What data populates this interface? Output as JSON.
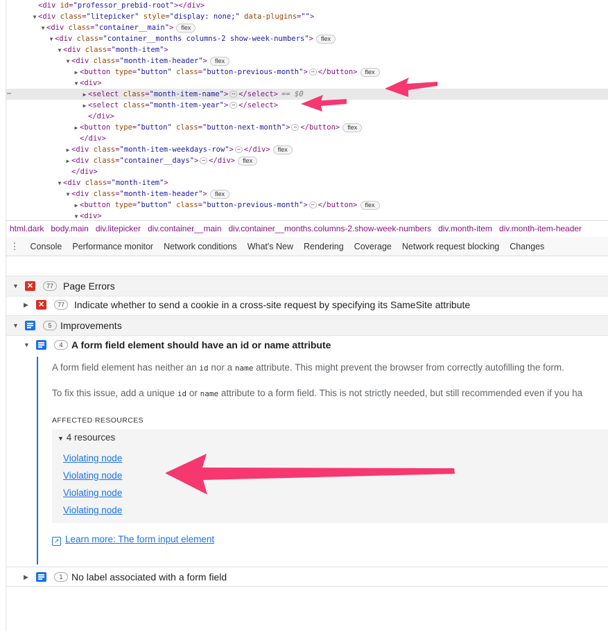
{
  "elements_tree": {
    "lines": [
      {
        "indent": 2,
        "toggle": "",
        "open": "<div ",
        "attrs": [
          {
            "n": "id",
            "v": "professor_prebid-root"
          }
        ],
        "close": "></div>",
        "badge": ""
      },
      {
        "indent": 2,
        "toggle": "▼",
        "open": "<div ",
        "attrs": [
          {
            "n": "class",
            "v": "litepicker"
          },
          {
            "n": "style",
            "v": "display: none;"
          },
          {
            "n": "data-plugins",
            "v": ""
          }
        ],
        "close": ">",
        "badge": ""
      },
      {
        "indent": 3,
        "toggle": "▼",
        "open": "<div ",
        "attrs": [
          {
            "n": "class",
            "v": "container__main"
          }
        ],
        "close": ">",
        "badge": "flex"
      },
      {
        "indent": 4,
        "toggle": "▼",
        "open": "<div ",
        "attrs": [
          {
            "n": "class",
            "v": "container__months columns-2 show-week-numbers"
          }
        ],
        "close": ">",
        "badge": "flex"
      },
      {
        "indent": 5,
        "toggle": "▼",
        "open": "<div ",
        "attrs": [
          {
            "n": "class",
            "v": "month-item"
          }
        ],
        "close": ">",
        "badge": ""
      },
      {
        "indent": 6,
        "toggle": "▼",
        "open": "<div ",
        "attrs": [
          {
            "n": "class",
            "v": "month-item-header"
          }
        ],
        "close": ">",
        "badge": "flex"
      },
      {
        "indent": 7,
        "toggle": "▶",
        "open": "<button ",
        "attrs": [
          {
            "n": "type",
            "v": "button"
          },
          {
            "n": "class",
            "v": "button-previous-month"
          }
        ],
        "close": ">",
        "ellipsis": true,
        "end": "</button>",
        "badge": "flex"
      },
      {
        "indent": 7,
        "toggle": "▼",
        "open": "<div>",
        "attrs": [],
        "close": "",
        "badge": ""
      },
      {
        "indent": 8,
        "toggle": "▶",
        "open": "<select ",
        "attrs": [
          {
            "n": "class",
            "v": "month-item-name"
          }
        ],
        "close": ">",
        "ellipsis": true,
        "end": "</select>",
        "badge": "",
        "selected": true,
        "dollar": "== $0"
      },
      {
        "indent": 8,
        "toggle": "▶",
        "open": "<select ",
        "attrs": [
          {
            "n": "class",
            "v": "month-item-year"
          }
        ],
        "close": ">",
        "ellipsis": true,
        "end": "</select>",
        "badge": ""
      },
      {
        "indent": 8,
        "toggle": "",
        "open": "</div>",
        "attrs": [],
        "close": "",
        "badge": ""
      },
      {
        "indent": 7,
        "toggle": "▶",
        "open": "<button ",
        "attrs": [
          {
            "n": "type",
            "v": "button"
          },
          {
            "n": "class",
            "v": "button-next-month"
          }
        ],
        "close": ">",
        "ellipsis": true,
        "end": "</button>",
        "badge": "flex"
      },
      {
        "indent": 7,
        "toggle": "",
        "open": "</div>",
        "attrs": [],
        "close": "",
        "badge": ""
      },
      {
        "indent": 6,
        "toggle": "▶",
        "open": "<div ",
        "attrs": [
          {
            "n": "class",
            "v": "month-item-weekdays-row"
          }
        ],
        "close": ">",
        "ellipsis": true,
        "end": "</div>",
        "badge": "flex"
      },
      {
        "indent": 6,
        "toggle": "▶",
        "open": "<div ",
        "attrs": [
          {
            "n": "class",
            "v": "container__days"
          }
        ],
        "close": ">",
        "ellipsis": true,
        "end": "</div>",
        "badge": "flex"
      },
      {
        "indent": 6,
        "toggle": "",
        "open": "</div>",
        "attrs": [],
        "close": "",
        "badge": ""
      },
      {
        "indent": 5,
        "toggle": "▼",
        "open": "<div ",
        "attrs": [
          {
            "n": "class",
            "v": "month-item"
          }
        ],
        "close": ">",
        "badge": ""
      },
      {
        "indent": 6,
        "toggle": "▼",
        "open": "<div ",
        "attrs": [
          {
            "n": "class",
            "v": "month-item-header"
          }
        ],
        "close": ">",
        "badge": "flex"
      },
      {
        "indent": 7,
        "toggle": "▶",
        "open": "<button ",
        "attrs": [
          {
            "n": "type",
            "v": "button"
          },
          {
            "n": "class",
            "v": "button-previous-month"
          }
        ],
        "close": ">",
        "ellipsis": true,
        "end": "</button>",
        "badge": "flex"
      },
      {
        "indent": 7,
        "toggle": "▼",
        "open": "<div>",
        "attrs": [],
        "close": "",
        "badge": ""
      }
    ]
  },
  "breadcrumbs": [
    "html.dark",
    "body.main",
    "div.litepicker",
    "div.container__main",
    "div.container__months.columns-2.show-week-numbers",
    "div.month-item",
    "div.month-item-header"
  ],
  "drawer": {
    "menu_icon": "⋮",
    "tabs": [
      "Console",
      "Performance monitor",
      "Network conditions",
      "What's New",
      "Rendering",
      "Coverage",
      "Network request blocking",
      "Changes"
    ]
  },
  "issues": {
    "page_errors": {
      "count": "77",
      "label": "Page Errors"
    },
    "samesite": {
      "count": "77",
      "label": "Indicate whether to send a cookie in a cross-site request by specifying its SameSite attribute"
    },
    "improvements": {
      "count": "5",
      "label": "Improvements"
    },
    "form_field": {
      "count": "4",
      "label": "A form field element should have an id or name attribute"
    },
    "desc1": {
      "a": "A form field element has neither an ",
      "c1": "id",
      "b": " nor a ",
      "c2": "name",
      "c": " attribute. This might prevent the browser from correctly autofilling the form."
    },
    "desc2": {
      "a": "To fix this issue, add a unique ",
      "c1": "id",
      "b": " or ",
      "c2": "name",
      "c": " attribute to a form field. This is not strictly needed, but still recommended even if you ha"
    },
    "affected_heading": "AFFECTED RESOURCES",
    "resources_label": "4 resources",
    "resources": [
      "Violating node",
      "Violating node",
      "Violating node",
      "Violating node"
    ],
    "learn_more": "Learn more: The form input element",
    "no_label": {
      "count": "1",
      "label": "No label associated with a form field"
    }
  },
  "colors": {
    "annotation_arrow": "#f7376f",
    "link": "#1a73e8",
    "error": "#d93025"
  },
  "icons": {
    "error": "error-icon",
    "improvement": "improvement-icon",
    "external_link": "external-link-icon"
  }
}
